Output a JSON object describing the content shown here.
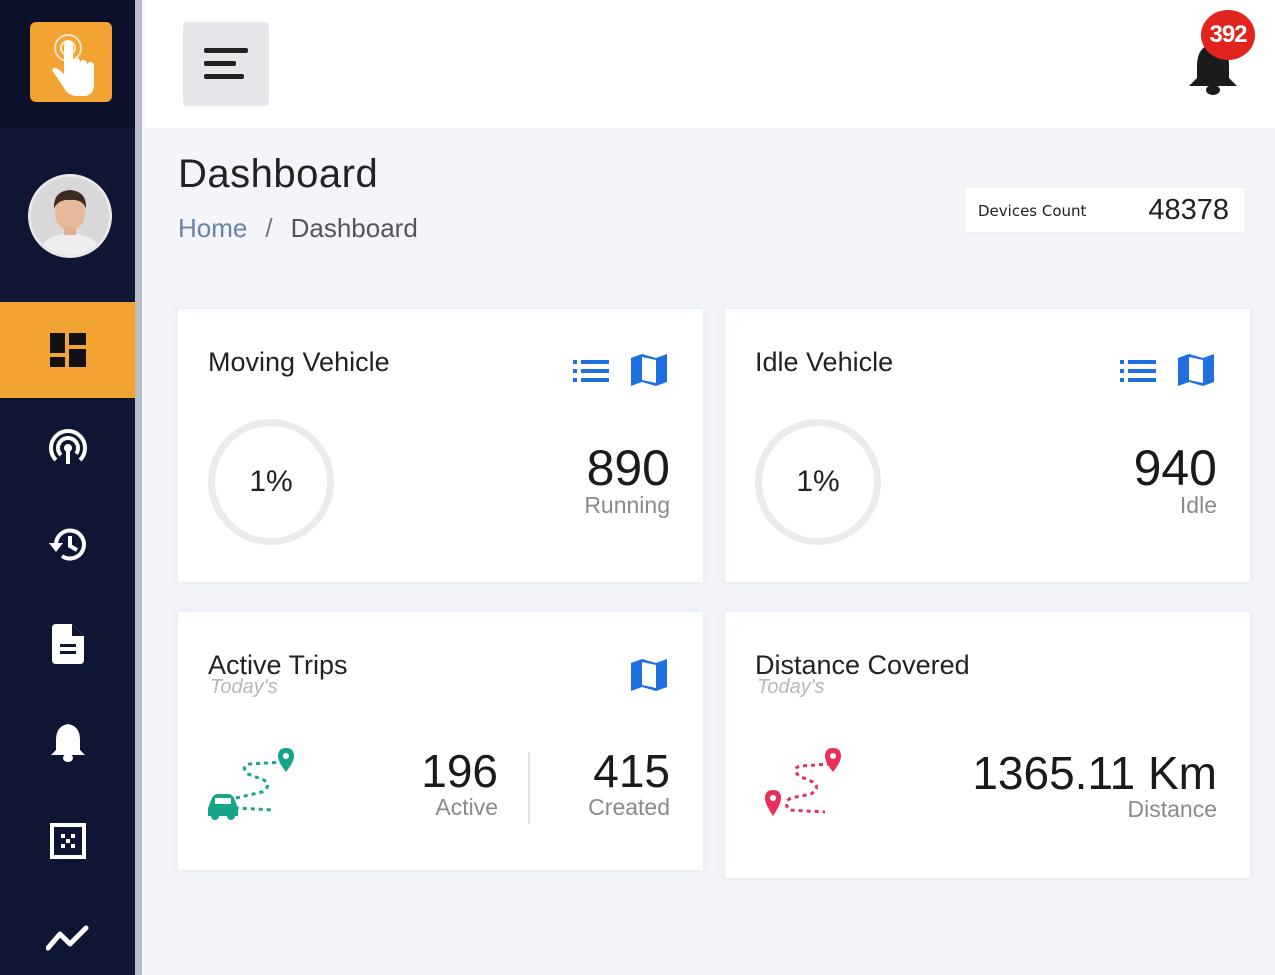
{
  "topbar": {
    "notification_count": "392"
  },
  "page": {
    "title": "Dashboard",
    "breadcrumb": {
      "home": "Home",
      "separator": "/",
      "current": "Dashboard"
    }
  },
  "devices_count": {
    "label": "Devices Count",
    "value": "48378"
  },
  "sidebar": {
    "items": [
      {
        "icon": "dashboard-icon",
        "active": true
      },
      {
        "icon": "live-tracking-icon",
        "active": false
      },
      {
        "icon": "history-icon",
        "active": false
      },
      {
        "icon": "report-icon",
        "active": false
      },
      {
        "icon": "alerts-icon",
        "active": false
      },
      {
        "icon": "grid-icon",
        "active": false
      },
      {
        "icon": "analytics-icon",
        "active": false
      }
    ]
  },
  "cards": {
    "moving": {
      "title": "Moving Vehicle",
      "percent": "1%",
      "value": "890",
      "label": "Running"
    },
    "idle": {
      "title": "Idle Vehicle",
      "percent": "1%",
      "value": "940",
      "label": "Idle"
    },
    "trips": {
      "title": "Active Trips",
      "subtitle": "Today's",
      "active_value": "196",
      "active_label": "Active",
      "created_value": "415",
      "created_label": "Created"
    },
    "distance": {
      "title": "Distance Covered",
      "subtitle": "Today's",
      "value": "1365.11 Km",
      "label": "Distance"
    }
  },
  "colors": {
    "sidebar_bg": "#0e1633",
    "accent": "#f3a331",
    "icon_blue": "#1e6fe0",
    "route_green": "#17a58a",
    "route_red": "#e8305a",
    "badge_red": "#e2241f"
  }
}
